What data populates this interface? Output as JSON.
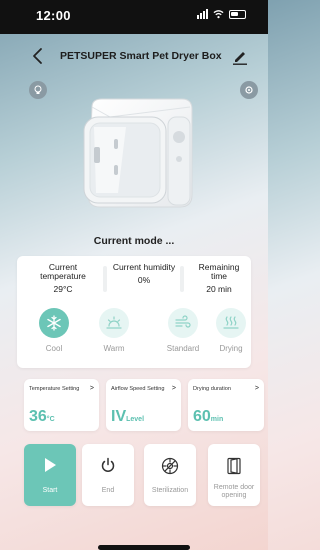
{
  "status_bar": {
    "time": "12:00"
  },
  "header": {
    "title": "PETSUPER Smart Pet Dryer Box"
  },
  "current_mode": "Current mode ...",
  "stats": {
    "temperature": {
      "label": "Current temperature",
      "value": "29°C"
    },
    "humidity": {
      "label": "Current humidity",
      "value": "0%"
    },
    "remaining": {
      "label": "Remaining time",
      "value": "20 min"
    }
  },
  "modes": [
    {
      "label": "Cool",
      "icon": "snowflake-icon",
      "selected": true
    },
    {
      "label": "Warm",
      "icon": "sun-icon",
      "selected": false
    },
    {
      "label": "Standard",
      "icon": "wind-icon",
      "selected": false
    },
    {
      "label": "Drying",
      "icon": "heat-waves-icon",
      "selected": false
    }
  ],
  "settings": {
    "temperature": {
      "label": "Temperature Setting",
      "value": "36",
      "unit": "°C"
    },
    "airflow": {
      "label": "Airflow Speed Setting",
      "value": "IV",
      "unit": "Level"
    },
    "drying": {
      "label": "Drying duration",
      "value": "60",
      "unit": "min"
    }
  },
  "actions": {
    "start": "Start",
    "end": "End",
    "sterilization": "Sterilization",
    "remote": "Remote door opening"
  },
  "colors": {
    "accent": "#6cc6b7",
    "accent_light": "#e6f5f3",
    "status_bar": "#111111"
  }
}
